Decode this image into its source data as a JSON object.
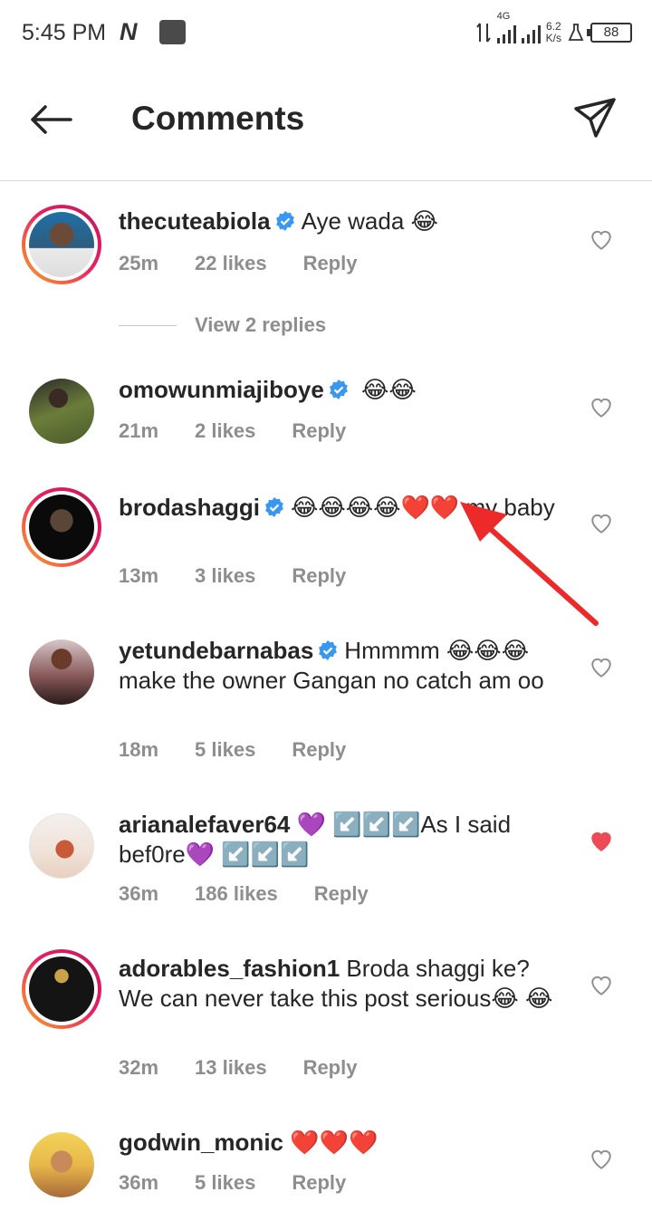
{
  "status_bar": {
    "time": "5:45 PM",
    "carrier_glyph": "N",
    "network": "4G",
    "speed_value": "6.2",
    "speed_unit": "K/s",
    "battery": "88"
  },
  "header": {
    "title": "Comments"
  },
  "colors": {
    "verified_blue": "#3897f0",
    "liked_red": "#ed4956",
    "annotation_red": "#ec2a2a",
    "story_ring": "#e91e63"
  },
  "view_replies_label": "View 2 replies",
  "comments": [
    {
      "username": "thecuteabiola",
      "verified": true,
      "text": "Aye wada 😂",
      "time": "25m",
      "likes": "22 likes",
      "reply_label": "Reply",
      "liked": false
    },
    {
      "username": "omowunmiajiboye",
      "verified": true,
      "text": " 😂😂",
      "time": "21m",
      "likes": "2 likes",
      "reply_label": "Reply",
      "liked": false
    },
    {
      "username": "brodashaggi",
      "verified": true,
      "text": "😂😂😂😂❤️❤️ my baby",
      "time": "13m",
      "likes": "3 likes",
      "reply_label": "Reply",
      "liked": false
    },
    {
      "username": "yetundebarnabas",
      "verified": true,
      "text": "Hmmmm 😂😂😂 make the owner Gangan no catch am oo",
      "time": "18m",
      "likes": "5 likes",
      "reply_label": "Reply",
      "liked": false
    },
    {
      "username": "arianalefaver64",
      "verified": false,
      "text": " 💜 ↙️↙️↙️As I said bef0re💜 ↙️↙️↙️",
      "time": "36m",
      "likes": "186 likes",
      "reply_label": "Reply",
      "liked": true
    },
    {
      "username": "adorables_fashion1",
      "verified": false,
      "text": " Broda shaggi ke? We can never take this post serious😂 😂",
      "time": "32m",
      "likes": "13 likes",
      "reply_label": "Reply",
      "liked": false
    },
    {
      "username": "godwin_monic",
      "verified": false,
      "text": " ❤️❤️❤️",
      "time": "36m",
      "likes": "5 likes",
      "reply_label": "Reply",
      "liked": false
    }
  ]
}
